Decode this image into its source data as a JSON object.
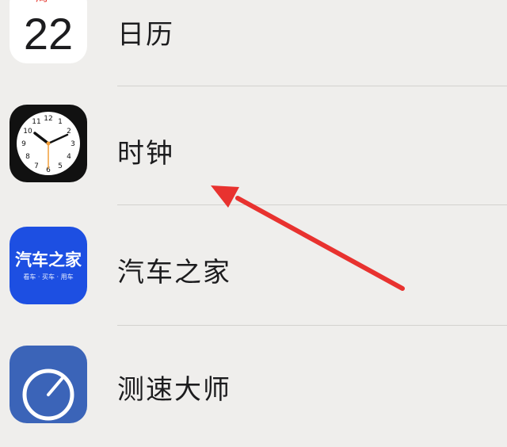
{
  "apps": [
    {
      "label": "日历",
      "icon": "calendar-icon",
      "calendar_weekday": "周一",
      "calendar_date": "22"
    },
    {
      "label": "时钟",
      "icon": "clock-icon"
    },
    {
      "label": "汽车之家",
      "icon": "autohome-icon",
      "icon_title": "汽车之家",
      "icon_subtitle": "看车 · 买车 · 用车"
    },
    {
      "label": "测速大师",
      "icon": "speedtest-icon"
    }
  ],
  "annotation": {
    "type": "red-arrow",
    "color": "#e8322f",
    "points_to": "clock-app-row"
  },
  "colors": {
    "background": "#efeeec",
    "calendar_red": "#e8453c",
    "autohome_blue": "#1d4fe2",
    "speedtest_blue": "#3b64b8"
  }
}
